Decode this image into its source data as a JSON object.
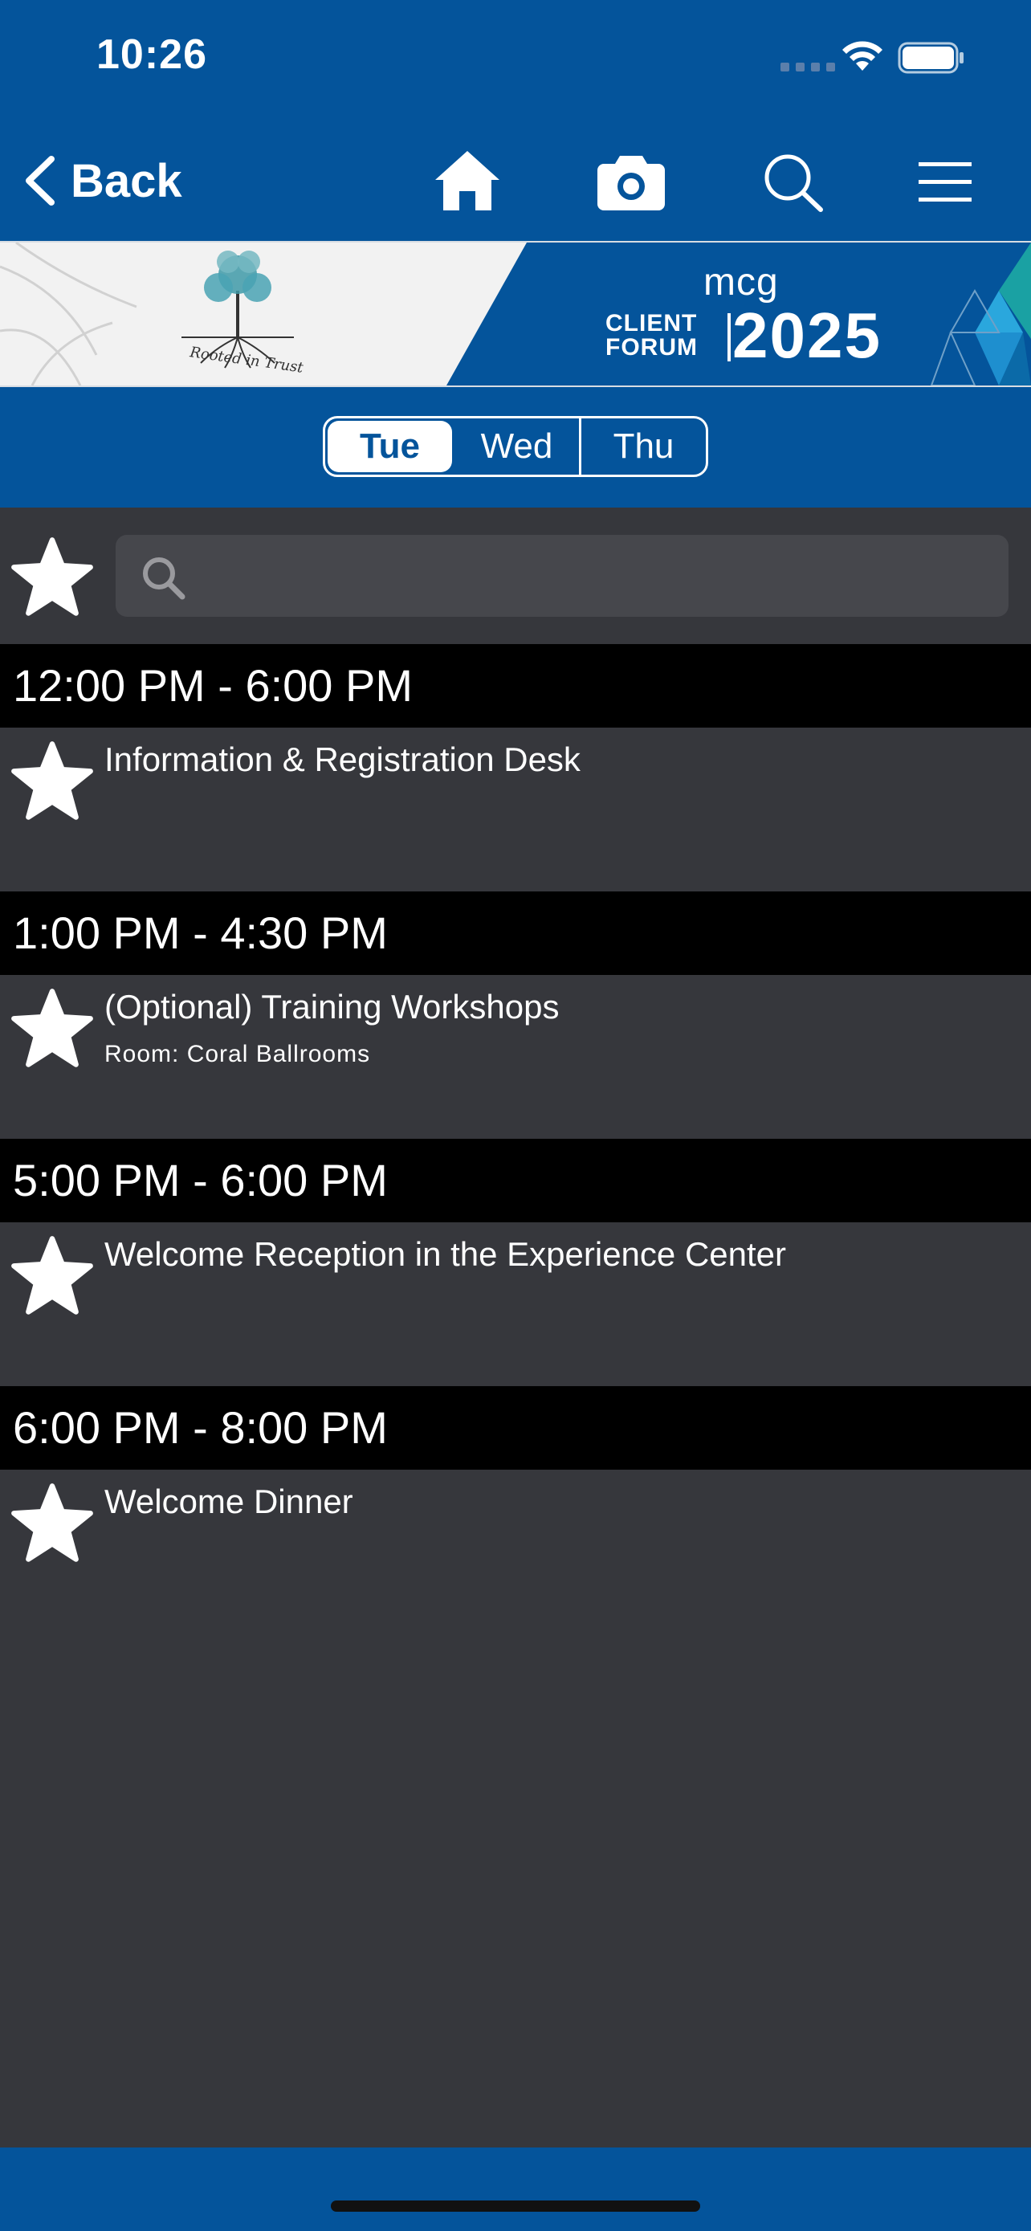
{
  "status_bar": {
    "time": "10:26",
    "icons": [
      "cellular-icon",
      "wifi-icon",
      "battery-icon"
    ]
  },
  "nav": {
    "back_label": "Back",
    "icons": [
      "home-icon",
      "camera-icon",
      "search-icon",
      "menu-icon"
    ]
  },
  "banner": {
    "tagline": "Rooted in Trust",
    "brand": "mcg",
    "event_line1": "CLIENT",
    "event_line2": "FORUM",
    "event_year": "2025"
  },
  "days": {
    "tabs": [
      "Tue",
      "Wed",
      "Thu"
    ],
    "selected": "Tue"
  },
  "search": {
    "placeholder": ""
  },
  "schedule": [
    {
      "time": "12:00 PM - 6:00 PM",
      "title": "Information & Registration Desk",
      "room": ""
    },
    {
      "time": "1:00 PM - 4:30 PM",
      "title": "(Optional) Training Workshops",
      "room": "Room: Coral Ballrooms"
    },
    {
      "time": "5:00 PM - 6:00 PM",
      "title": "Welcome Reception in the Experience Center",
      "room": ""
    },
    {
      "time": "6:00 PM - 8:00 PM",
      "title": "Welcome Dinner",
      "room": ""
    }
  ],
  "colors": {
    "primary": "#04549b",
    "background": "#36373c",
    "time_header": "#000000",
    "search_field": "#46474c"
  }
}
